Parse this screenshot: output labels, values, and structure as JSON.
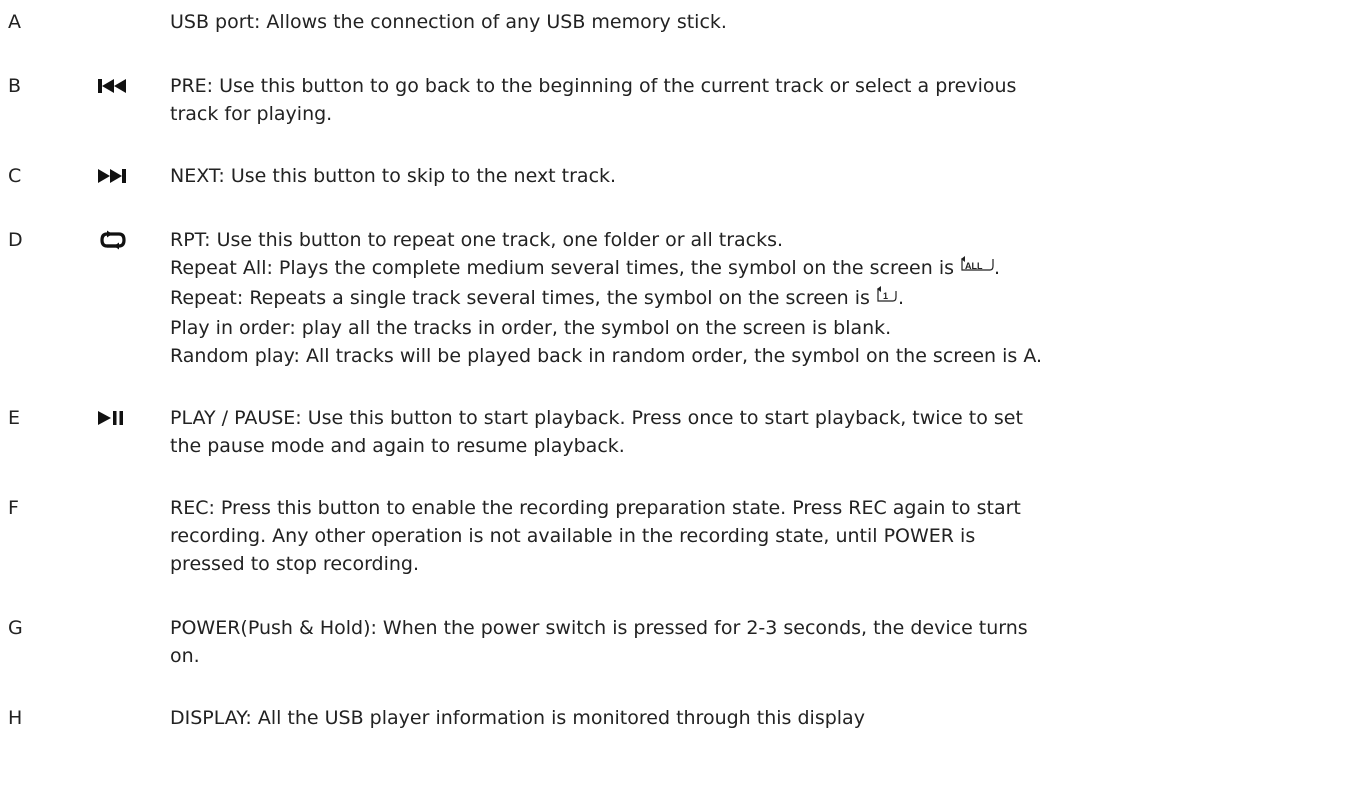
{
  "entries": [
    {
      "letter": "A",
      "icon": "",
      "lines": [
        "USB port: Allows the connection of any USB memory stick."
      ]
    },
    {
      "letter": "B",
      "icon": "previous-track-icon",
      "lines": [
        "PRE: Use this button to go back to the beginning of the current track or select a previous",
        "track for playing."
      ]
    },
    {
      "letter": "C",
      "icon": "next-track-icon",
      "lines": [
        "NEXT: Use this button to skip to the next track."
      ]
    },
    {
      "letter": "D",
      "icon": "repeat-icon",
      "lines": [
        "RPT: Use this button to repeat one track, one folder or all tracks.",
        "Repeat All: Plays the complete medium several times, the symbol on the screen is",
        "Repeat: Repeats a single track several times, the symbol on the screen is",
        "Play in order: play all the tracks in order, the symbol on the screen is blank.",
        "Random play: All tracks will be played back in random order, the symbol on the screen is A."
      ],
      "repeat_all_symbol_text": "ALL",
      "repeat_one_symbol_text": "1",
      "sentence_end": "."
    },
    {
      "letter": "E",
      "icon": "play-pause-icon",
      "lines": [
        "PLAY / PAUSE:  Use this button to start playback. Press once to start playback, twice to set",
        "the pause mode and again to resume playback."
      ]
    },
    {
      "letter": "F",
      "icon": "",
      "lines": [
        "REC: Press this button to enable the recording preparation state. Press REC again to start",
        "recording. Any other operation is not available in the recording state, until POWER is",
        "pressed to stop recording."
      ]
    },
    {
      "letter": "G",
      "icon": "",
      "lines": [
        "POWER(Push & Hold): When the power switch is pressed for 2-3 seconds, the device turns",
        "on."
      ]
    },
    {
      "letter": "H",
      "icon": "",
      "lines": [
        "DISPLAY: All the USB player information is monitored through this display"
      ]
    }
  ]
}
